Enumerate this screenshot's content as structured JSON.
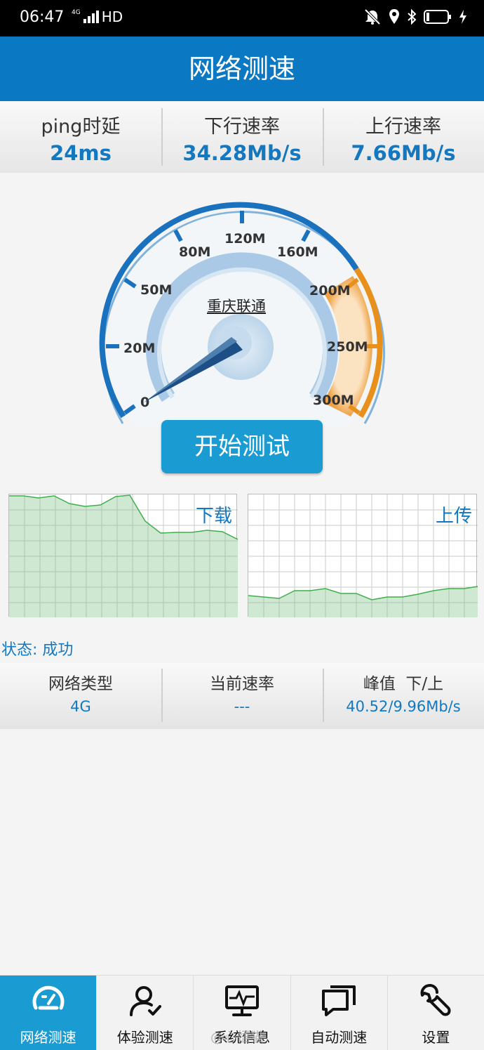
{
  "status_bar": {
    "time": "06:47",
    "network_type": "4G",
    "signal_label": "HD"
  },
  "header": {
    "title": "网络测速"
  },
  "metrics": [
    {
      "label": "ping时延",
      "value": "24ms"
    },
    {
      "label": "下行速率",
      "value": "34.28Mb/s"
    },
    {
      "label": "上行速率",
      "value": "7.66Mb/s"
    }
  ],
  "gauge": {
    "isp": "重庆联通",
    "needle_value": 0,
    "ticks": [
      "0",
      "20M",
      "50M",
      "80M",
      "120M",
      "160M",
      "200M",
      "250M",
      "300M"
    ]
  },
  "start_button": {
    "label": "开始测试"
  },
  "graphs": {
    "download_label": "下载",
    "upload_label": "上传"
  },
  "status": {
    "text": "状态: 成功"
  },
  "info": [
    {
      "label": "网络类型",
      "value": "4G"
    },
    {
      "label": "当前速率",
      "value": "---"
    },
    {
      "label": "峰值  下/上",
      "value": "40.52/9.96Mb/s"
    }
  ],
  "nav": [
    {
      "label": "网络测速",
      "icon": "speedometer-icon",
      "active": true
    },
    {
      "label": "体验测速",
      "icon": "user-check-icon",
      "active": false
    },
    {
      "label": "系统信息",
      "icon": "monitor-pulse-icon",
      "active": false
    },
    {
      "label": "自动测速",
      "icon": "chat-windows-icon",
      "active": false
    },
    {
      "label": "设置",
      "icon": "wrench-icon",
      "active": false
    }
  ],
  "colors": {
    "header": "#0a78c2",
    "accent": "#1a9bd2",
    "value_text": "#1478c0",
    "gauge_orange": "#e8901c",
    "graph_fill": "#cfe8d1",
    "graph_line": "#3fae4b"
  },
  "watermark": "@心悟猫"
}
